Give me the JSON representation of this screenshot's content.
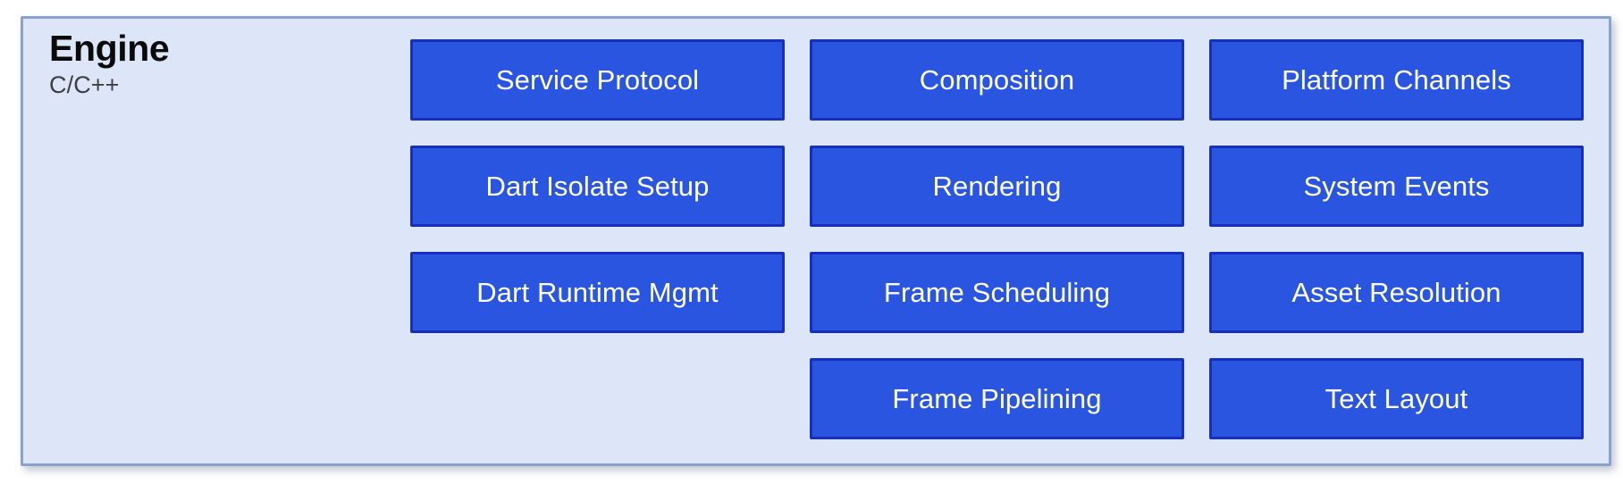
{
  "diagram": {
    "type": "layered-architecture-block-diagram",
    "panel": {
      "title": "Engine",
      "subtitle": "C/C++",
      "background_color": "#dce6f8",
      "border_color": "#8ba3cc"
    },
    "box_style": {
      "fill_color": "#2a55e0",
      "border_color": "#1630bd",
      "text_color": "#ffffff"
    },
    "columns": [
      {
        "name": "column-1",
        "modules": [
          {
            "label": "Service Protocol"
          },
          {
            "label": "Dart Isolate Setup"
          },
          {
            "label": "Dart Runtime Mgmt"
          }
        ]
      },
      {
        "name": "column-2",
        "modules": [
          {
            "label": "Composition"
          },
          {
            "label": "Rendering"
          },
          {
            "label": "Frame Scheduling"
          },
          {
            "label": "Frame Pipelining"
          }
        ]
      },
      {
        "name": "column-3",
        "modules": [
          {
            "label": "Platform Channels"
          },
          {
            "label": "System Events"
          },
          {
            "label": "Asset Resolution"
          },
          {
            "label": "Text Layout"
          }
        ]
      }
    ]
  }
}
